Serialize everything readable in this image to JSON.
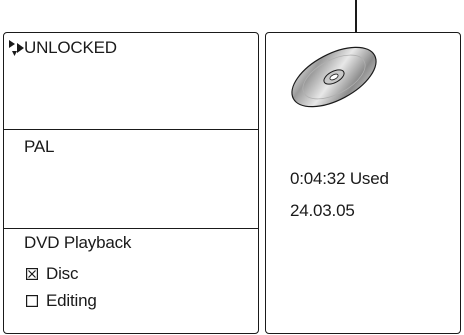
{
  "display": {
    "lock_status": "UNLOCKED",
    "tv_system": "PAL",
    "mode_title": "DVD Playback",
    "options": [
      {
        "label": "Disc",
        "checked": true
      },
      {
        "label": "Editing",
        "checked": false
      }
    ],
    "time_used": "0:04:32 Used",
    "date": "24.03.05"
  },
  "icons": {
    "lock": "play-rewind-cursor-icon",
    "disc": "disc-icon",
    "checkbox_checked": "checked-box-icon",
    "checkbox_unchecked": "unchecked-box-icon"
  }
}
